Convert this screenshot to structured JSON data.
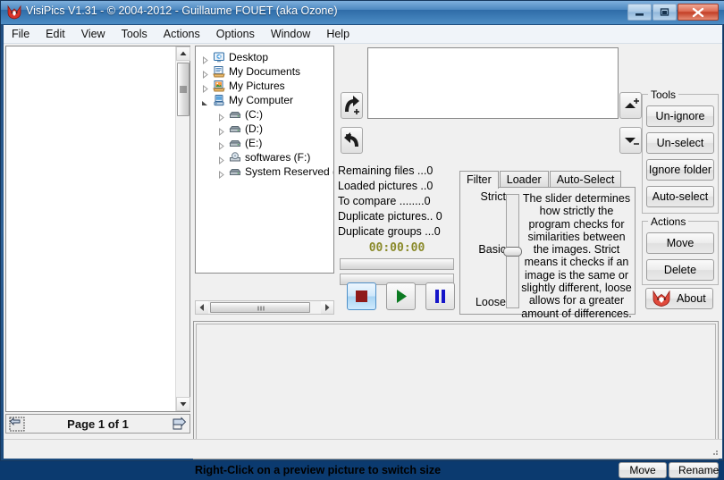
{
  "window": {
    "title": "VisiPics V1.31 - © 2004-2012 - Guillaume FOUET (aka Ozone)",
    "icon": "fox-icon",
    "minimize_label": "Minimize",
    "maximize_label": "Maximize",
    "close_label": "Close",
    "accent_titlebar": "#4d88c0",
    "accent_close": "#c33f26"
  },
  "menu": {
    "items": [
      {
        "label": "File"
      },
      {
        "label": "Edit"
      },
      {
        "label": "View"
      },
      {
        "label": "Tools"
      },
      {
        "label": "Actions"
      },
      {
        "label": "Options"
      },
      {
        "label": "Window"
      },
      {
        "label": "Help"
      }
    ]
  },
  "tree": {
    "nodes": [
      {
        "label": "Desktop",
        "indent": 0,
        "icon": "desktop-icon",
        "expanded": false
      },
      {
        "label": "My Documents",
        "indent": 0,
        "icon": "documents-icon",
        "expanded": false
      },
      {
        "label": "My Pictures",
        "indent": 0,
        "icon": "pictures-icon",
        "expanded": false
      },
      {
        "label": "My Computer",
        "indent": 0,
        "icon": "computer-icon",
        "expanded": true
      },
      {
        "label": "(C:)",
        "indent": 1,
        "icon": "drive-icon",
        "expanded": false
      },
      {
        "label": "(D:)",
        "indent": 1,
        "icon": "drive-icon",
        "expanded": false
      },
      {
        "label": "(E:)",
        "indent": 1,
        "icon": "drive-icon",
        "expanded": false
      },
      {
        "label": "softwares (F:)",
        "indent": 1,
        "icon": "cd-drive-icon",
        "expanded": false
      },
      {
        "label": "System Reserved (I",
        "indent": 1,
        "icon": "drive-icon",
        "expanded": false
      }
    ]
  },
  "folder_actions": {
    "add_icon": "arrow-add-folder-icon",
    "subtract_icon": "arrow-remove-folder-icon",
    "move_up_icon": "move-up-plus-icon",
    "move_down_icon": "move-down-minus-icon"
  },
  "folder_list": {
    "items": []
  },
  "stats": {
    "lines": [
      "Remaining files ...0",
      "Loaded pictures ..0",
      "To compare ........0",
      "Duplicate pictures.. 0",
      "Duplicate groups ...0"
    ],
    "timer": "00:00:00",
    "progress_primary": 0,
    "progress_secondary": 0
  },
  "transport": {
    "stop_label": "Stop",
    "play_label": "Start",
    "pause_label": "Pause",
    "stop_color": "#8f1a1a",
    "play_color": "#0c7a22",
    "pause_color": "#1515c9"
  },
  "tabs": {
    "active": "Filter",
    "items": [
      {
        "label": "Filter"
      },
      {
        "label": "Loader"
      },
      {
        "label": "Auto-Select"
      }
    ]
  },
  "filter": {
    "slider_top_label": "Strict",
    "slider_mid_label": "Basic",
    "slider_bottom_label": "Loose",
    "slider_value": "Basic",
    "description": "The slider determines how strictly the program checks for similarities between the images. Strict means it checks if an image is the same or slightly different, loose allows for a greater amount of differences."
  },
  "tools": {
    "group_label": "Tools",
    "buttons": [
      {
        "label": "Un-ignore"
      },
      {
        "label": "Un-select"
      },
      {
        "label": "Ignore folder"
      },
      {
        "label": "Auto-select"
      }
    ]
  },
  "actions": {
    "group_label": "Actions",
    "buttons": [
      {
        "label": "Move"
      },
      {
        "label": "Delete"
      }
    ]
  },
  "about": {
    "label": "About",
    "icon": "fox-icon"
  },
  "pager": {
    "label": "Page 1 of 1",
    "prev_icon": "page-prev-icon",
    "next_icon": "page-next-icon"
  },
  "statusbar": {
    "hint": "Right-Click on a preview picture to switch size",
    "move_label": "Move",
    "rename_label": "Rename"
  }
}
